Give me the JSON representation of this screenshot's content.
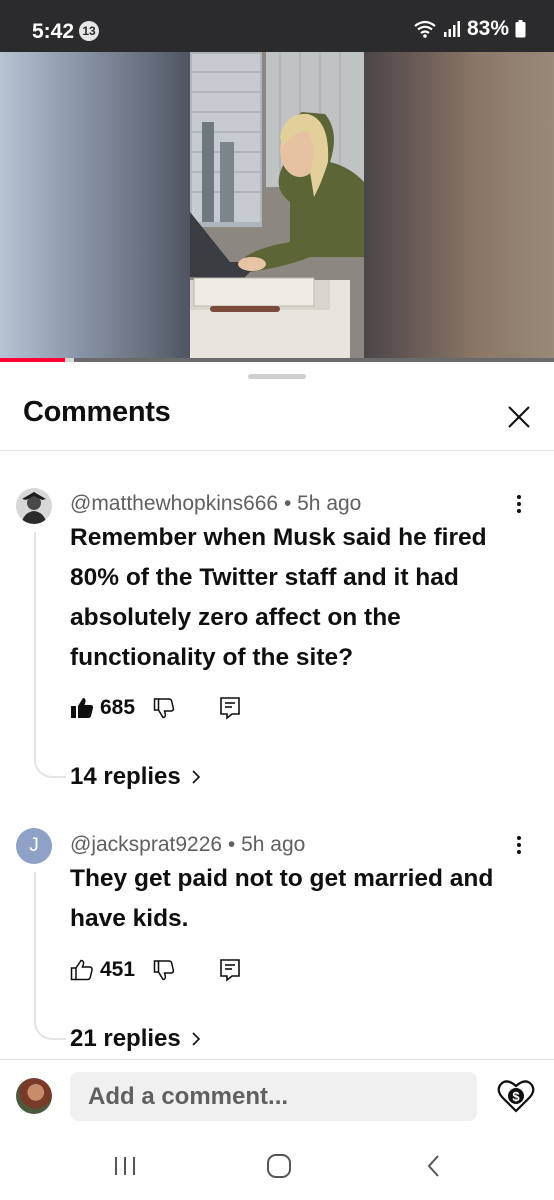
{
  "status_bar": {
    "time": "5:42",
    "notification_count": "13",
    "battery": "83%"
  },
  "video": {
    "progress_fraction": 0.118,
    "buffer_fraction": 0.133
  },
  "sheet": {
    "title": "Comments"
  },
  "comments": [
    {
      "meta": "@matthewhopkins666 • 5h ago",
      "text": "Remember when Musk said he fired 80% of the Twitter staff and it had absolutely zero affect on the functionality of the site?",
      "likes": "685",
      "liked": true,
      "replies": "14 replies"
    },
    {
      "avatar_letter": "J",
      "meta": "@jacksprat9226 • 5h ago",
      "text": "They get paid not to get married and have kids.",
      "likes": "451",
      "liked": false,
      "replies": "21 replies"
    }
  ],
  "composer": {
    "placeholder": "Add a comment..."
  },
  "colors": {
    "progress": "#ff0033",
    "status_bar": "#2b2b2d",
    "avatar_j": "#8da2c6"
  },
  "icons": [
    "close-icon",
    "more-vert-icon",
    "thumb-up-icon",
    "thumb-down-icon",
    "reply-icon",
    "chevron-right-icon",
    "thanks-heart-icon",
    "recents-icon",
    "home-icon",
    "back-icon",
    "wifi-icon",
    "signal-icon",
    "battery-icon"
  ]
}
